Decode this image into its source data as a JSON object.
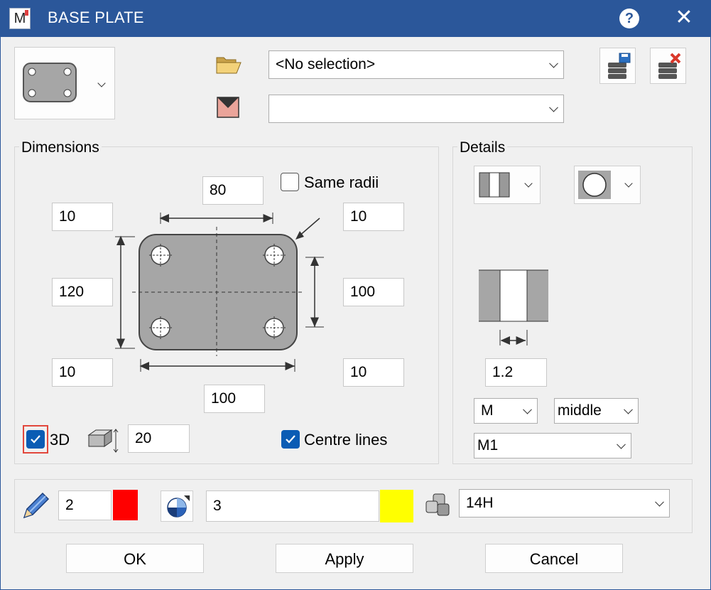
{
  "window": {
    "title": "BASE PLATE",
    "app_icon_letter": "M"
  },
  "top": {
    "profile_select": "<No selection>",
    "second_select": ""
  },
  "dimensions": {
    "group_label": "Dimensions",
    "same_radii_label": "Same radii",
    "same_radii_checked": false,
    "top_width": "80",
    "top_left": "10",
    "top_right": "10",
    "left_height": "120",
    "right_height": "100",
    "bottom_left": "10",
    "bottom_right": "10",
    "bottom_width": "100",
    "three_d_label": "3D",
    "three_d_checked": true,
    "thickness": "20",
    "centre_lines_label": "Centre lines",
    "centre_lines_checked": true
  },
  "details": {
    "group_label": "Details",
    "gap_value": "1.2",
    "bolt_select": "M",
    "position_select": "middle",
    "m_select": "M1"
  },
  "bottom": {
    "pen_value": "2",
    "pen_color": "#ff0000",
    "layer_value": "3",
    "layer_color": "#ffff00",
    "material_select": "14H"
  },
  "buttons": {
    "ok": "OK",
    "apply": "Apply",
    "cancel": "Cancel"
  }
}
